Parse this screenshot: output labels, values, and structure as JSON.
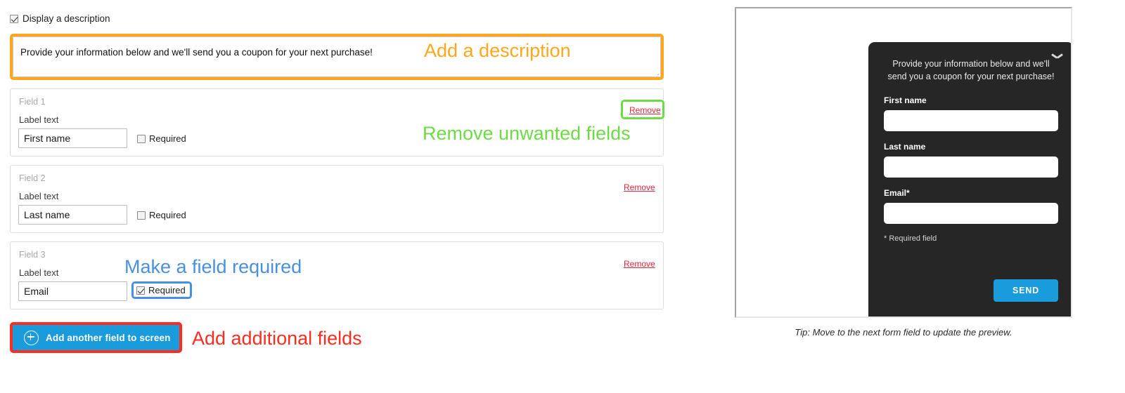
{
  "editor": {
    "display_description": {
      "label": "Display a description",
      "checked": true
    },
    "description": {
      "value": "Provide your information below and we'll send you a coupon for your next purchase!",
      "annotation": "Add a description",
      "annotation_color": "#FFA81E"
    },
    "label_text_caption": "Label text",
    "required_label": "Required",
    "remove_label": "Remove",
    "fields": [
      {
        "index_label": "Field 1",
        "caption": "Label text",
        "value": "First name",
        "required": false,
        "remove": "Remove"
      },
      {
        "index_label": "Field 2",
        "caption": "Label text",
        "value": "Last name",
        "required": false,
        "remove": "Remove"
      },
      {
        "index_label": "Field 3",
        "caption": "Label text",
        "value": "Email",
        "required": true,
        "remove": "Remove"
      }
    ],
    "annotations": {
      "remove_fields": "Remove unwanted fields",
      "remove_fields_color": "#6EDB45",
      "make_required": "Make a field required",
      "make_required_color": "#4A90E2",
      "add_fields": "Add additional fields",
      "add_fields_color": "#FF2D20"
    },
    "add_button": {
      "label": "Add another field to screen",
      "icon": "plus-circle-icon",
      "color": "#1A9BDC"
    }
  },
  "preview": {
    "chat": {
      "intro": "Provide your information below and we'll send you a coupon for your next purchase!",
      "collapse_icon": "chevron-down-icon",
      "fields": [
        {
          "label": "First name",
          "value": ""
        },
        {
          "label": "Last name",
          "value": ""
        },
        {
          "label": "Email*",
          "value": ""
        }
      ],
      "required_note": "* Required field",
      "send_label": "SEND",
      "send_color": "#1A9BDC",
      "background": "#262626"
    },
    "tip": "Tip: Move to the next form field to update the preview."
  }
}
